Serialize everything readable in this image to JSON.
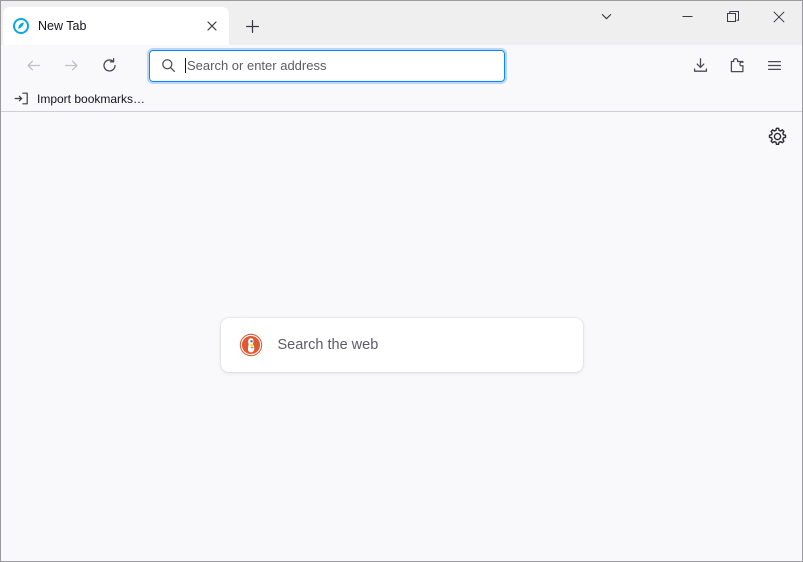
{
  "window": {
    "controls": {
      "tablist_label": "List all tabs",
      "minimize_label": "Minimize",
      "maximize_label": "Restore Down",
      "close_label": "Close"
    }
  },
  "tabstrip": {
    "tabs": [
      {
        "title": "New Tab",
        "favicon": "firefox-default-favicon",
        "close_label": "Close tab",
        "active": true
      }
    ],
    "new_tab_label": "Open a new tab",
    "new_tab_icon": "plus-icon"
  },
  "toolbar": {
    "back": {
      "label": "Go back one page",
      "icon": "arrow-left-icon",
      "disabled": true
    },
    "forward": {
      "label": "Go forward one page",
      "icon": "arrow-right-icon",
      "disabled": true
    },
    "reload": {
      "label": "Reload current page",
      "icon": "reload-icon",
      "disabled": false
    },
    "downloads": {
      "label": "Downloads",
      "icon": "download-icon"
    },
    "extensions": {
      "label": "Extensions",
      "icon": "puzzle-piece-icon"
    },
    "app_menu": {
      "label": "Open application menu",
      "icon": "hamburger-menu-icon"
    }
  },
  "urlbar": {
    "value": "",
    "placeholder": "Search or enter address",
    "icon": "search-icon",
    "focused": true,
    "accent_color": "#0a84ff"
  },
  "bookmarks_bar": {
    "items": [
      {
        "label": "Import bookmarks…",
        "icon": "import-bookmarks-icon"
      }
    ]
  },
  "newtab": {
    "settings_button": {
      "label": "Personalize new tab page",
      "icon": "gear-icon"
    },
    "search": {
      "engine": "DuckDuckGo",
      "engine_icon": "duckduckgo-logo",
      "placeholder": "Search the web"
    },
    "background_color": "#f9f9fb"
  }
}
